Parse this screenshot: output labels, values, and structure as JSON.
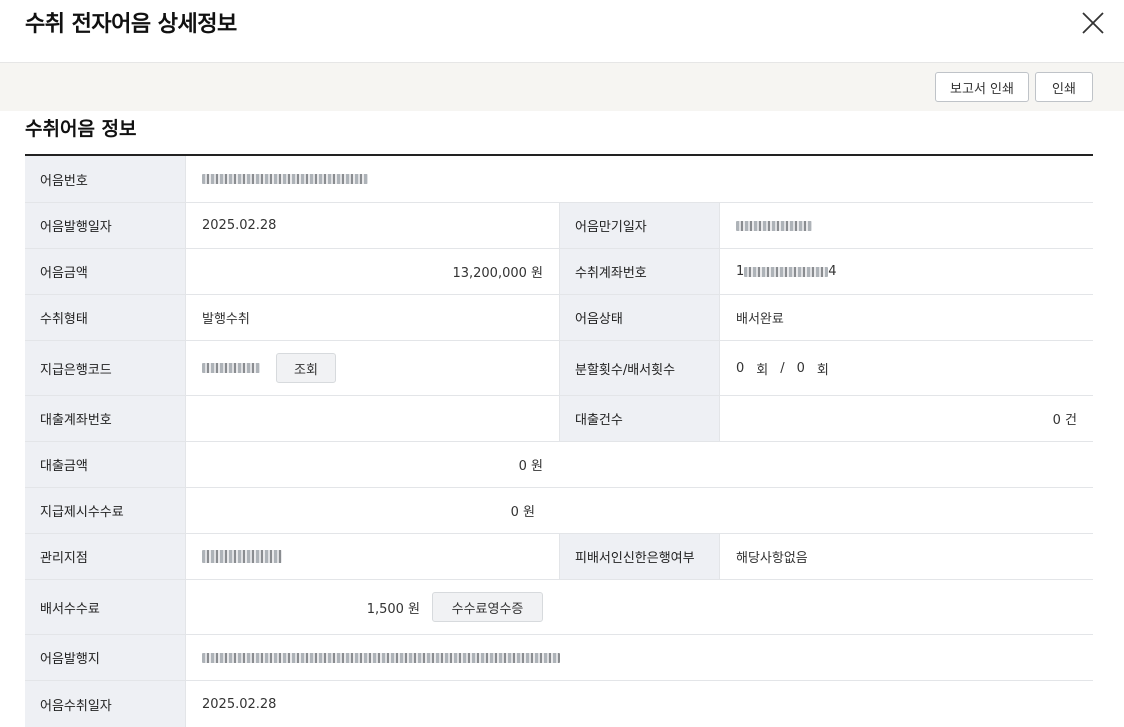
{
  "dialog": {
    "title": "수취 전자어음 상세정보"
  },
  "toolbar": {
    "report_print_label": "보고서 인쇄",
    "print_label": "인쇄"
  },
  "section": {
    "title": "수취어음 정보"
  },
  "fields": {
    "note_number": {
      "label": "어음번호",
      "value": ""
    },
    "issue_date": {
      "label": "어음발행일자",
      "value": "2025.02.28"
    },
    "maturity_date": {
      "label": "어음만기일자",
      "value": ""
    },
    "amount": {
      "label": "어음금액",
      "value": "13,200,000 원"
    },
    "receive_account": {
      "label": "수취계좌번호",
      "prefix": "1",
      "suffix": "4"
    },
    "receive_type": {
      "label": "수취형태",
      "value": "발행수취"
    },
    "note_status": {
      "label": "어음상태",
      "value": "배서완료"
    },
    "pay_bank_code": {
      "label": "지급은행코드",
      "value": "",
      "button": "조회"
    },
    "split_endorse": {
      "label": "분할횟수/배서횟수",
      "split": "0",
      "split_unit": "회",
      "sep": "/",
      "endorse": "0",
      "endorse_unit": "회"
    },
    "loan_account": {
      "label": "대출계좌번호",
      "value": ""
    },
    "loan_count": {
      "label": "대출건수",
      "value": "0 건"
    },
    "loan_amount": {
      "label": "대출금액",
      "value": "0 원"
    },
    "present_fee": {
      "label": "지급제시수수료",
      "value": "0 원"
    },
    "branch": {
      "label": "관리지점",
      "value": ""
    },
    "endorsee_bank": {
      "label": "피배서인신한은행여부",
      "value": "해당사항없음"
    },
    "endorse_fee": {
      "label": "배서수수료",
      "value": "1,500 원",
      "button": "수수료영수증"
    },
    "issue_place": {
      "label": "어음발행지",
      "value": ""
    },
    "receive_date": {
      "label": "어음수취일자",
      "value": "2025.02.28"
    }
  },
  "icons": {
    "close": "close-icon"
  }
}
